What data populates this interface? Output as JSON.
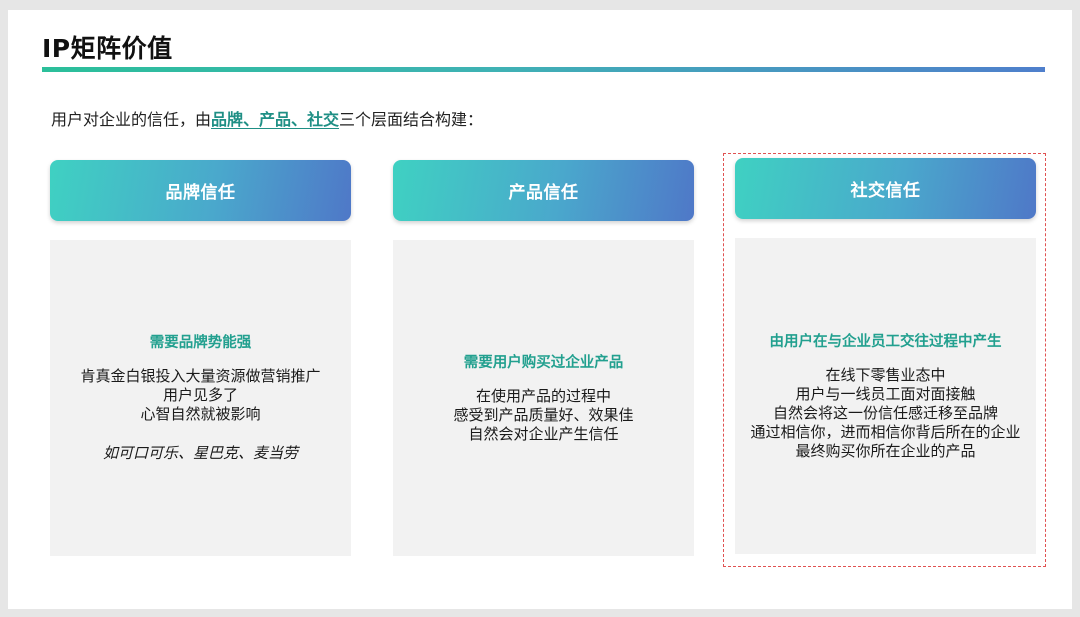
{
  "title": "IP矩阵价值",
  "intro": {
    "prefix": "用户对企业的信任，由",
    "highlight": "品牌、产品、社交",
    "suffix": "三个层面结合构建："
  },
  "columns": [
    {
      "header": "品牌信任",
      "heading": "需要品牌势能强",
      "lines": [
        "肯真金白银投入大量资源做营销推广",
        "用户见多了",
        "心智自然就被影响"
      ],
      "example": "如可口可乐、星巴克、麦当劳"
    },
    {
      "header": "产品信任",
      "heading": "需要用户购买过企业产品",
      "lines": [
        "在使用产品的过程中",
        "感受到产品质量好、效果佳",
        "自然会对企业产生信任"
      ]
    },
    {
      "header": "社交信任",
      "heading": "由用户在与企业员工交往过程中产生",
      "lines": [
        "在线下零售业态中",
        "用户与一线员工面对面接触",
        "自然会将这一份信任感迁移至品牌",
        "通过相信你，进而相信你背后所在的企业",
        "最终购买你所在企业的产品"
      ]
    }
  ],
  "colors": {
    "accent_green": "#22a08f",
    "header_gradient_start": "#3fd1c2",
    "header_gradient_end": "#4f78c8",
    "frame_red": "#e05252"
  }
}
